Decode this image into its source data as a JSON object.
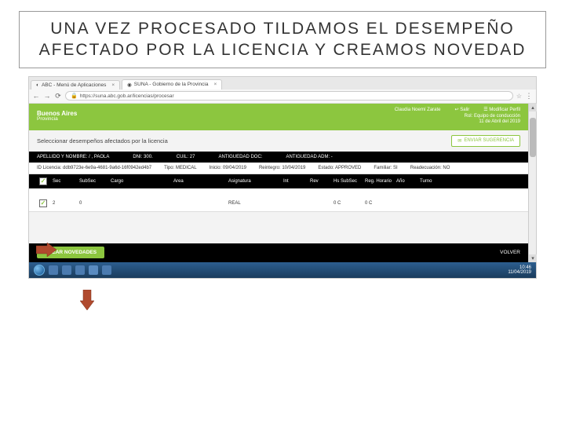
{
  "slide": {
    "title": "UNA VEZ PROCESADO TILDAMOS EL DESEMPEÑO AFECTADO POR LA LICENCIA Y CREAMOS NOVEDAD"
  },
  "tabs": [
    {
      "label": "ABC - Menú de Aplicaciones",
      "active": false
    },
    {
      "label": "SUNA - Gobierno de la Provincia",
      "active": true
    }
  ],
  "address": {
    "url": "https://suna.abc.gob.ar/licencias/procesar"
  },
  "header": {
    "brand_line1": "Buenos Aires",
    "brand_line2": "Provincia",
    "user_name": "Claudia Noemí Zarate",
    "logout": "Salir",
    "modify": "Modificar Perfil",
    "role": "Rol: Equipo de conducción",
    "date": "11 de Abril del 2019"
  },
  "subtitle": "Seleccionar desempeños afectados por la licencia",
  "sugerencia_btn": "ENVIAR SUGERENCIA",
  "person_bar": {
    "name_label": "APELLIDO Y NOMBRE: /",
    "name_value": ", PAOLA",
    "dni_label": "DNI: 300.",
    "cuil_label": "CUIL: 27",
    "antig_doc": "ANTIGUEDAD DOC:",
    "antig_adm": "ANTIGUEDAD ADM: -"
  },
  "license_info": {
    "id": "ID Licencia: ddb9723e-6e9a-4681-9a6d-16f0942ed4b7",
    "tipo": "Tipo: MEDICAL",
    "inicio": "Inicio: 09/04/2019",
    "reintegro": "Reintegro: 10/04/2019",
    "estado": "Estado: APPROVED",
    "familiar": "Familiar: SI",
    "readec": "Readecuación: NO"
  },
  "cols": {
    "sec": "Sec",
    "sub": "SubSec",
    "cargo": "Cargo",
    "area": "Area",
    "asig": "Asignatura",
    "int": "Int",
    "rev": "Rev",
    "hss": "Hs SubSec",
    "reg": "Reg. Horario",
    "ano": "Año",
    "turno": "Turno"
  },
  "row": {
    "sec": "2",
    "sub": "0",
    "cargo": "",
    "area": "",
    "asig": "REAL",
    "int": "",
    "rev": "",
    "hss": "0 C",
    "reg": "0 C",
    "ano": "",
    "turno": ""
  },
  "buttons": {
    "crear": "CREAR NOVEDADES",
    "volver": "VOLVER"
  },
  "clock": {
    "time": "10:46",
    "date": "11/04/2019"
  }
}
